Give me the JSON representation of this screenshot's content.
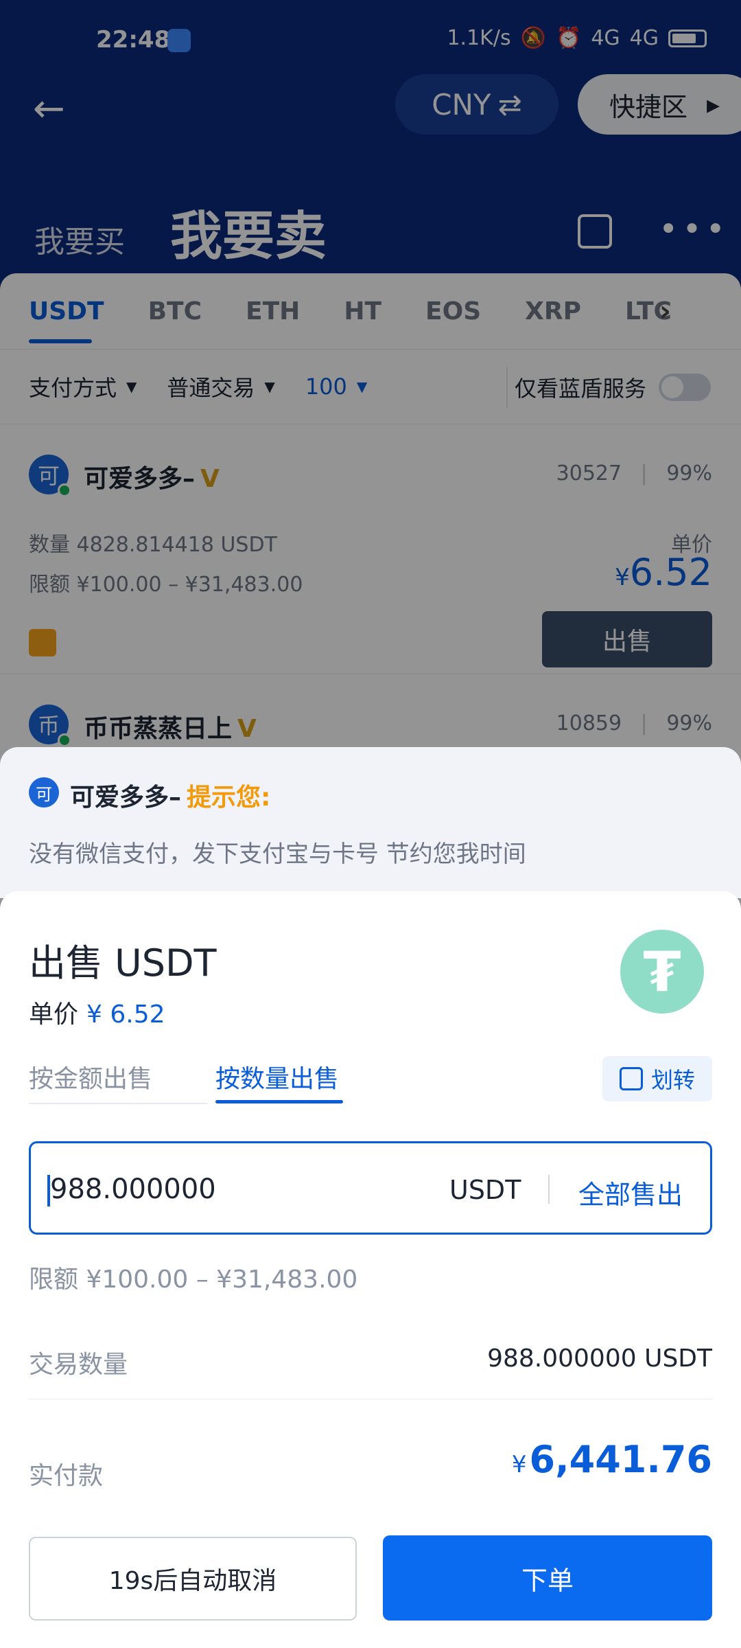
{
  "status_bar": {
    "time": "22:48",
    "net_speed": "1.1K/s",
    "signal1": "4G",
    "signal2": "4G"
  },
  "topbar": {
    "currency": "CNY",
    "quick_zone": "快捷区"
  },
  "trade_tabs": {
    "buy": "我要买",
    "sell": "我要卖"
  },
  "coin_tabs": [
    "USDT",
    "BTC",
    "ETH",
    "HT",
    "EOS",
    "XRP",
    "LTC"
  ],
  "filters": {
    "payment": "支付方式",
    "trade_type": "普通交易",
    "amount": "100",
    "blue_shield": "仅看蓝盾服务"
  },
  "ads": [
    {
      "avatar": "可",
      "name": "可爱多多–",
      "orders": "30527",
      "rate": "99%",
      "quantity": "数量 4828.814418 USDT",
      "limit": "限额 ¥100.00 – ¥31,483.00",
      "unit_label": "单价",
      "price_symbol": "¥",
      "price": "6.52",
      "action": "出售"
    },
    {
      "avatar": "币",
      "name": "币币蒸蒸日上",
      "orders": "10859",
      "rate": "99%"
    }
  ],
  "notice": {
    "avatar": "可",
    "name": "可爱多多–",
    "tip": "提示您:",
    "message": "没有微信支付，发下支付宝与卡号 节约您我时间"
  },
  "dialog": {
    "title": "出售 USDT",
    "price_label": "单价",
    "price_value": "¥ 6.52",
    "tab_by_amount": "按金额出售",
    "tab_by_quantity": "按数量出售",
    "transfer": "划转",
    "input_value": "988.000000",
    "input_unit": "USDT",
    "sell_all": "全部售出",
    "limit": "限额 ¥100.00 – ¥31,483.00",
    "qty_label": "交易数量",
    "qty_value": "988.000000 USDT",
    "pay_label": "实付款",
    "pay_symbol": "¥",
    "pay_value": "6,441.76",
    "cancel": "19s后自动取消",
    "order": "下单"
  }
}
